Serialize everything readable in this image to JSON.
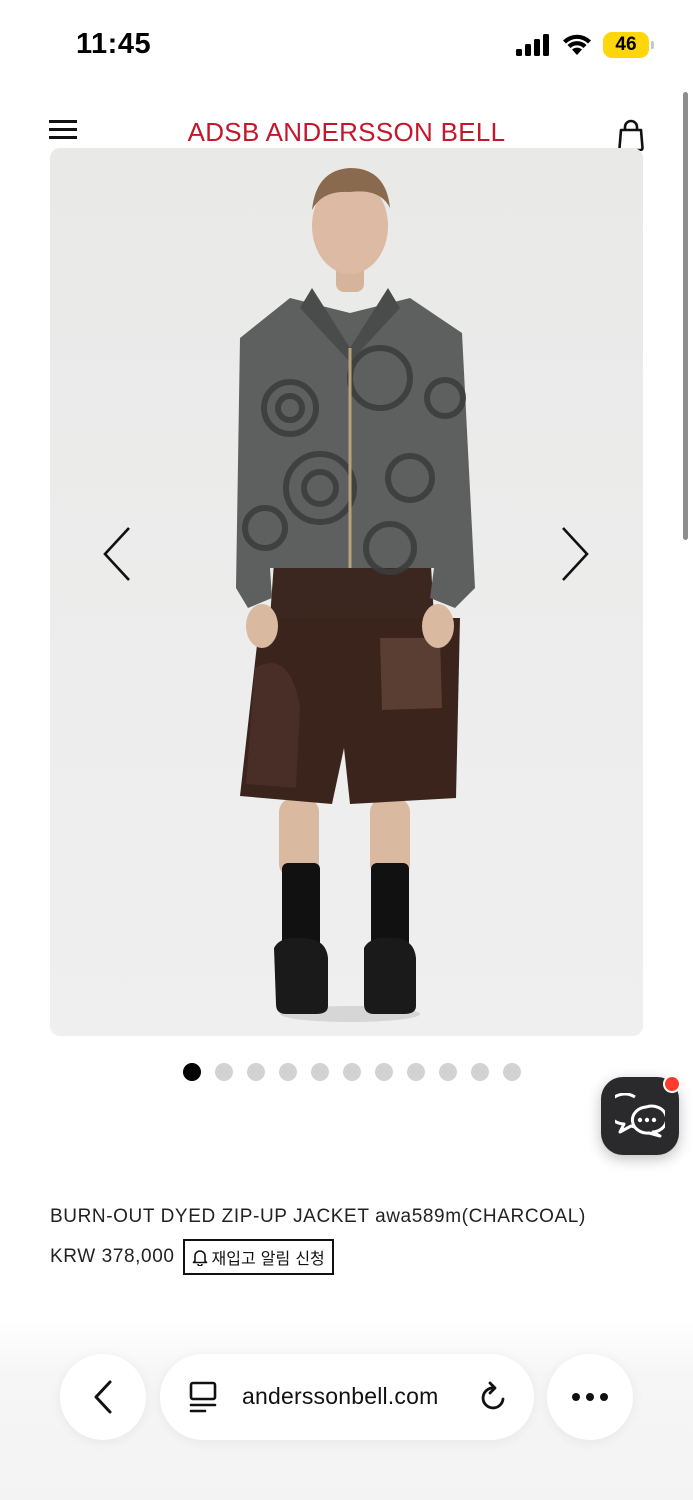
{
  "status_bar": {
    "time": "11:45",
    "battery": "46",
    "battery_color": "#ffd60a"
  },
  "header": {
    "brand": "ADSB  ANDERSSON BELL",
    "brand_color": "#c4172c",
    "icons": [
      "hamburger-menu-icon",
      "shopping-bag-icon"
    ]
  },
  "gallery": {
    "image_count": 11,
    "active_index": 0,
    "prev_icon": "chevron-left-icon",
    "next_icon": "chevron-right-icon"
  },
  "product": {
    "name": "BURN-OUT DYED ZIP-UP JACKET awa589m(CHARCOAL)",
    "price": "KRW 378,000",
    "restock_label": "재입고 알림 신청",
    "restock_icon": "bell-icon"
  },
  "chat": {
    "icon": "chat-bubbles-icon",
    "badge_color": "#ff3b30"
  },
  "browser": {
    "url": "anderssonbell.com",
    "icons": [
      "back-chevron-icon",
      "tabs-icon",
      "reload-icon",
      "more-dots-icon"
    ]
  }
}
